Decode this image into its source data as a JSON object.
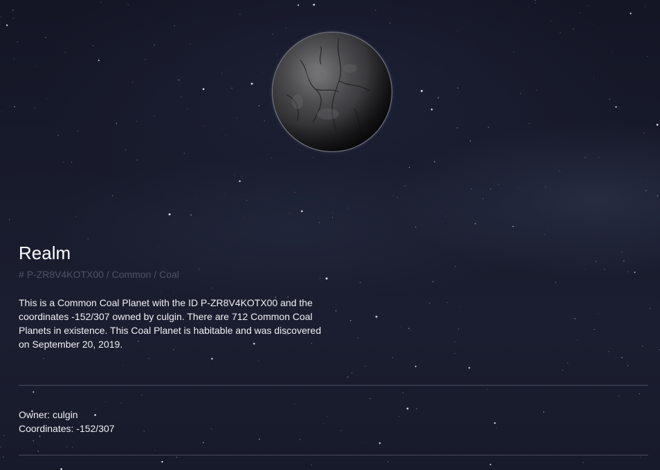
{
  "planet": {
    "name": "Realm",
    "id_prefix": "#",
    "id": "P-ZR8V4KOTX00",
    "separator": "/",
    "rarity": "Common",
    "type": "Coal",
    "description": "This is a Common Coal Planet with the ID P-ZR8V4KOTX00 and the coordinates -152/307 owned by culgin. There are 712 Common Coal Planets in existence. This Coal Planet is habitable and was discovered on September 20, 2019."
  },
  "details": {
    "owner_label": "Owner:",
    "owner": "culgin",
    "coordinates_label": "Coordinates:",
    "coordinates": "-152/307"
  },
  "colors": {
    "background": "#181b2c",
    "text": "#ffffff",
    "subtitle": "#4f5366",
    "divider": "#4a4d5c",
    "planet": "#3a3a3c"
  }
}
